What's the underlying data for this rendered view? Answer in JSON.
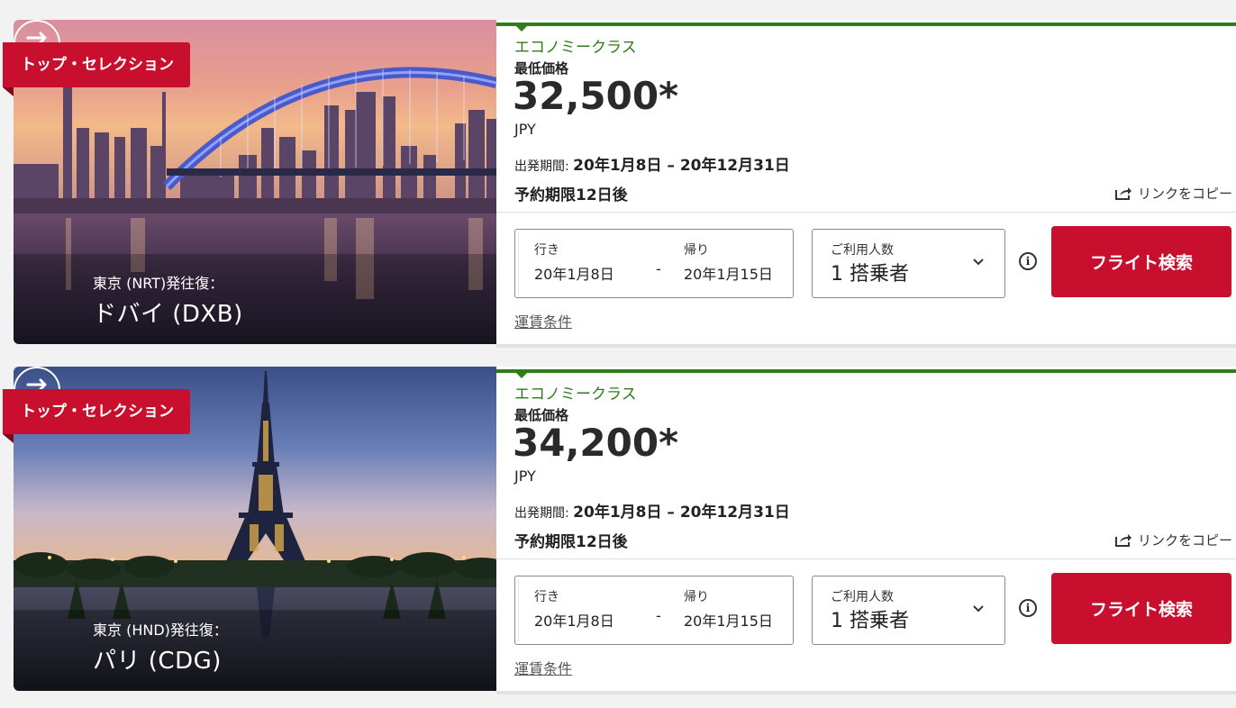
{
  "cards": [
    {
      "ribbon": "トップ・セレクション",
      "route_from": "東京 (NRT)発往復：",
      "route_to": "ドバイ (DXB)",
      "cabin": "エコノミークラス",
      "lowest_label": "最低価格",
      "price": "32,500*",
      "currency": "JPY",
      "period_label": "出発期間:",
      "period_value": "20年1月8日 – 20年12月31日",
      "deadline": "予約期限12日後",
      "copy_link": "リンクをコピー",
      "outbound_label": "行き",
      "outbound_date": "20年1月8日",
      "dash": "-",
      "return_label": "帰り",
      "return_date": "20年1月15日",
      "pax_label": "ご利用人数",
      "pax_value": "1 搭乗者",
      "search_button": "フライト検索",
      "fare_conditions": "運賃条件"
    },
    {
      "ribbon": "トップ・セレクション",
      "route_from": "東京 (HND)発往復：",
      "route_to": "パリ (CDG)",
      "cabin": "エコノミークラス",
      "lowest_label": "最低価格",
      "price": "34,200*",
      "currency": "JPY",
      "period_label": "出発期間:",
      "period_value": "20年1月8日 – 20年12月31日",
      "deadline": "予約期限12日後",
      "copy_link": "リンクをコピー",
      "outbound_label": "行き",
      "outbound_date": "20年1月8日",
      "dash": "-",
      "return_label": "帰り",
      "return_date": "20年1月15日",
      "pax_label": "ご利用人数",
      "pax_value": "1 搭乗者",
      "search_button": "フライト検索",
      "fare_conditions": "運賃条件"
    }
  ],
  "colors": {
    "brand_red": "#c8102e",
    "cabin_green": "#2e7d1a"
  },
  "icons": [
    "round-trip-icon",
    "share-icon",
    "chevron-down-icon",
    "info-icon"
  ]
}
